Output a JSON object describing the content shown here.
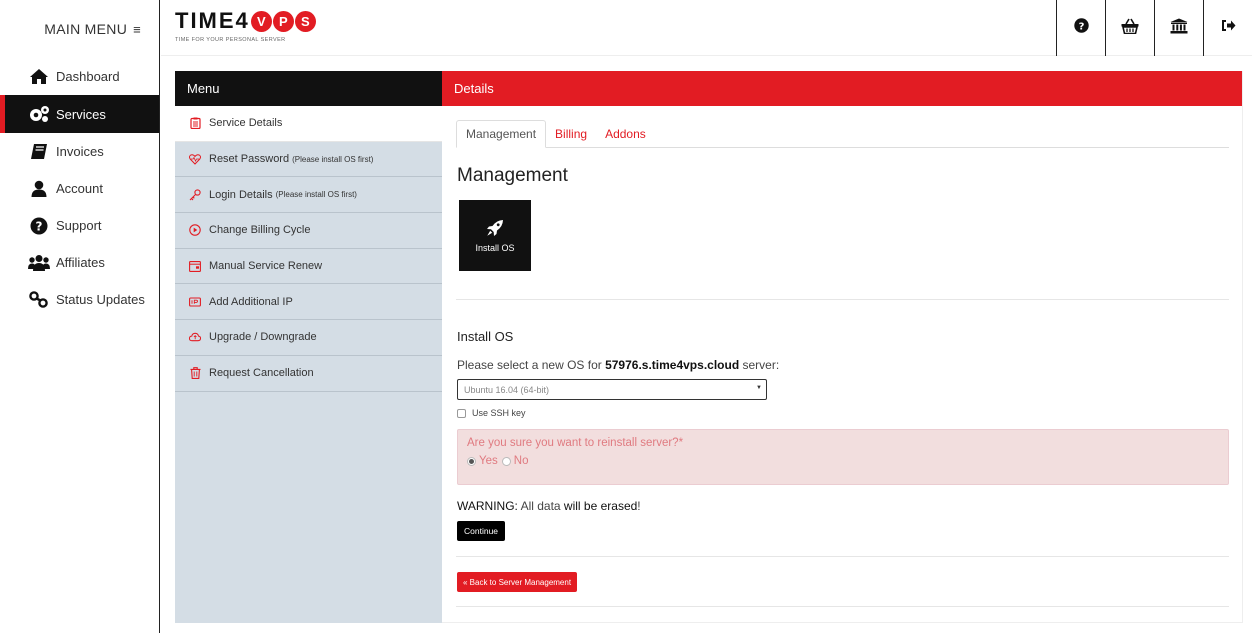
{
  "sidebar": {
    "main_menu_label": "MAIN MENU",
    "items": [
      {
        "label": "Dashboard",
        "icon": "home-icon"
      },
      {
        "label": "Services",
        "icon": "gears-icon",
        "active": true
      },
      {
        "label": "Invoices",
        "icon": "book-icon"
      },
      {
        "label": "Account",
        "icon": "user-icon"
      },
      {
        "label": "Support",
        "icon": "question-circle-icon"
      },
      {
        "label": "Affiliates",
        "icon": "users-icon"
      },
      {
        "label": "Status Updates",
        "icon": "key-icon"
      }
    ]
  },
  "header": {
    "logo_text": "TIME4",
    "logo_letters": [
      "V",
      "P",
      "S"
    ],
    "logo_tagline": "TIME FOR YOUR PERSONAL SERVER",
    "icons": [
      "help-icon",
      "basket-icon",
      "bank-icon",
      "logout-icon"
    ]
  },
  "service_menu": {
    "title": "Menu",
    "items": [
      {
        "label": "Service Details",
        "note": "",
        "icon": "clipboard-icon",
        "active": true
      },
      {
        "label": "Reset Password",
        "note": "(Please install OS first)",
        "icon": "heart-pulse-icon"
      },
      {
        "label": "Login Details",
        "note": "(Please install OS first)",
        "icon": "key-icon"
      },
      {
        "label": "Change Billing Cycle",
        "note": "",
        "icon": "cycle-icon"
      },
      {
        "label": "Manual Service Renew",
        "note": "",
        "icon": "wallet-icon"
      },
      {
        "label": "Add Additional IP",
        "note": "",
        "icon": "ip-icon"
      },
      {
        "label": "Upgrade / Downgrade",
        "note": "",
        "icon": "cloud-icon"
      },
      {
        "label": "Request Cancellation",
        "note": "",
        "icon": "trash-icon"
      }
    ]
  },
  "details": {
    "title": "Details",
    "tabs": [
      "Management",
      "Billing",
      "Addons"
    ],
    "heading": "Management",
    "install_tile_label": "Install OS",
    "install_section_title": "Install OS",
    "prompt_prefix": "Please select a new OS for ",
    "server_name": "57976.s.time4vps.cloud",
    "prompt_suffix": " server:",
    "os_selected": "Ubuntu 16.04 (64-bit)",
    "ssh_label": "Use SSH key",
    "confirm_question": "Are you sure you want to reinstall server?*",
    "yes_label": "Yes",
    "no_label": "No",
    "warning_prefix": "WARNING:",
    "warning_middle": " All data ",
    "warning_bold": "will be erased",
    "warning_suffix": "!",
    "continue_label": "Continue",
    "back_label": "« Back to Server Management"
  },
  "colors": {
    "accent": "#e21c23",
    "dark": "#111111",
    "menu_panel": "#d4dde5"
  }
}
